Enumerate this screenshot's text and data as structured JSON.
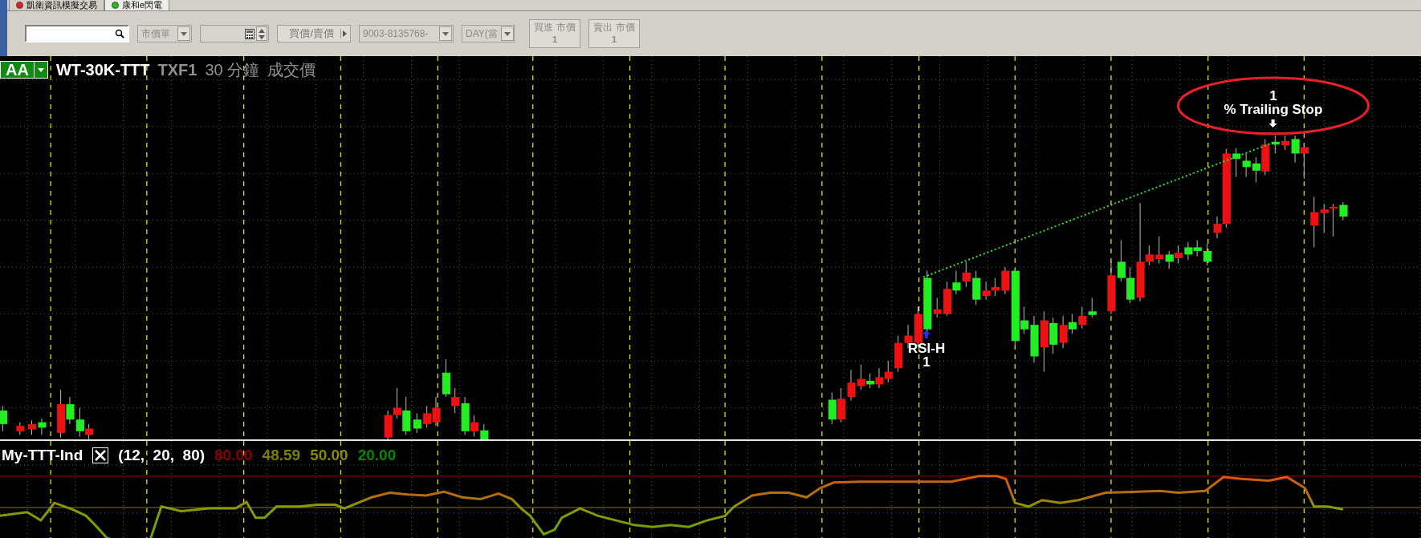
{
  "tabs": [
    {
      "label": "凱衛資訊模擬交易",
      "selected": false,
      "color": "#e02020"
    },
    {
      "label": "康和e閃電",
      "selected": true,
      "color": "#20c020"
    }
  ],
  "toolbar": {
    "order_type": "市價單",
    "quote_button": "買價/賣價",
    "account": "9003-8135768-",
    "duration": "DAY(當",
    "trade_buttons": [
      {
        "label": "買進 市價",
        "qty": "1"
      },
      {
        "label": "賣出 市價",
        "qty": "1"
      }
    ]
  },
  "chart": {
    "symbol_button": "AA",
    "strategy": "WT-30K-TTT",
    "contract": "TXF1",
    "interval": "30 分鐘",
    "price_type": "成交價",
    "annotations": [
      {
        "kind": "entry",
        "lines": [
          "RSI-H",
          "1"
        ],
        "circled": false
      },
      {
        "kind": "exit",
        "lines": [
          "1",
          "% Trailing Stop"
        ],
        "circled": true
      }
    ]
  },
  "indicator": {
    "name": "My-TTT-Ind",
    "params": "(12,  20,  80)",
    "values": [
      {
        "text": "80.00",
        "color": "#8b0000"
      },
      {
        "text": "48.59",
        "color": "#808000"
      },
      {
        "text": "50.00",
        "color": "#8a8a00"
      },
      {
        "text": "20.00",
        "color": "#008800"
      }
    ]
  }
}
